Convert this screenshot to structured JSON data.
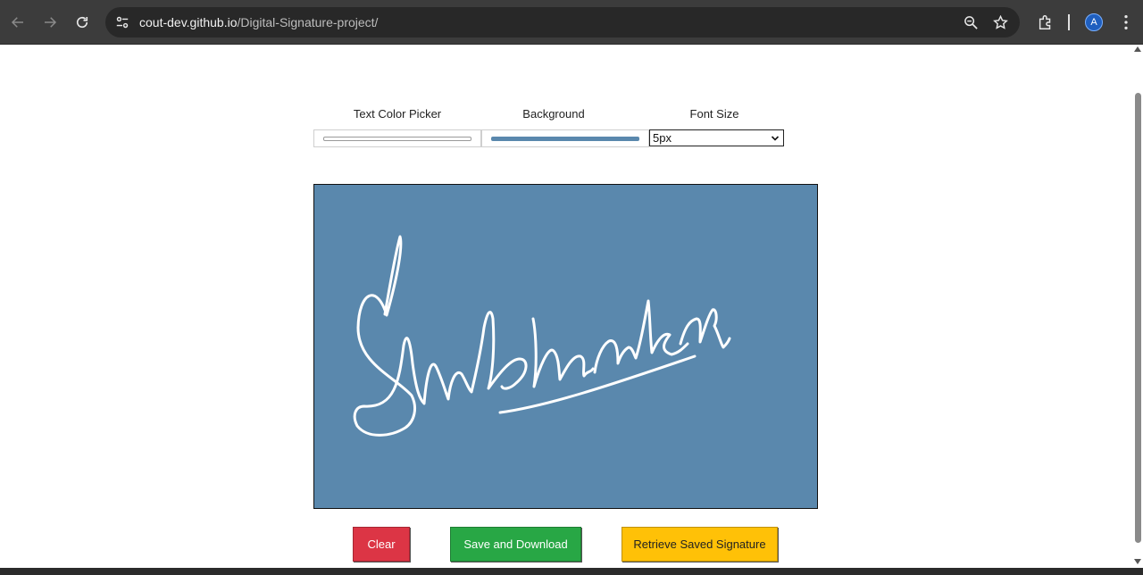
{
  "browser": {
    "url_host": "cout-dev.github.io",
    "url_path": "/Digital-Signature-project/",
    "avatar_letter": "A"
  },
  "controls": {
    "text_color_label": "Text Color Picker",
    "background_label": "Background",
    "font_size_label": "Font Size",
    "font_size_value": "5px",
    "text_color": "#ffffff",
    "background_color": "#5a88ad"
  },
  "canvas": {
    "background_color": "#5a88ad",
    "stroke_color": "#ffffff",
    "signature_text": "Shubhankar"
  },
  "buttons": {
    "clear_label": "Clear",
    "save_label": "Save and Download",
    "retrieve_label": "Retrieve Saved Signature",
    "clear_color": "#dc3545",
    "save_color": "#28a745",
    "retrieve_color": "#ffc107"
  }
}
